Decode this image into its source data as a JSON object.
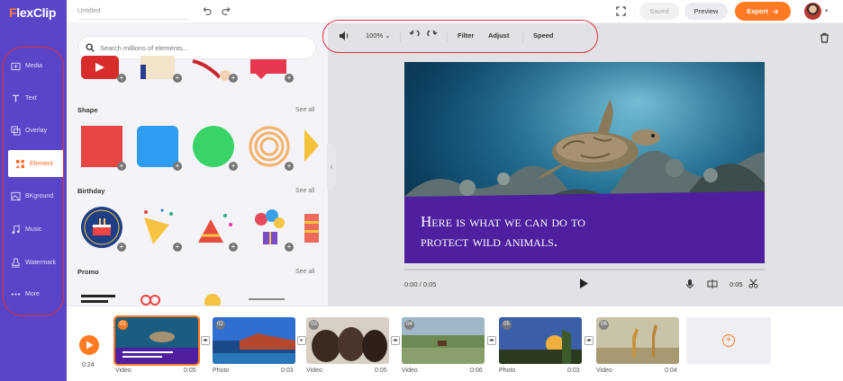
{
  "app": {
    "logo_f": "F",
    "logo_rest": "lexClip"
  },
  "colors": {
    "sidebar": "#5a44c7",
    "accent": "#ff7a22",
    "banner": "#4e1f9e",
    "highlight": "#e0323c"
  },
  "sidebar": {
    "items": [
      {
        "label": "Media",
        "icon": "media-icon"
      },
      {
        "label": "Text",
        "icon": "text-icon"
      },
      {
        "label": "Overlay",
        "icon": "overlay-icon"
      },
      {
        "label": "Element",
        "icon": "element-icon",
        "active": true
      },
      {
        "label": "BKground",
        "icon": "background-icon"
      },
      {
        "label": "Music",
        "icon": "music-icon"
      },
      {
        "label": "Watermark",
        "icon": "watermark-icon"
      },
      {
        "label": "More",
        "icon": "more-icon"
      }
    ]
  },
  "topbar": {
    "project_title": "Untitled",
    "saved_label": "Saved",
    "preview_label": "Preview",
    "export_label": "Export"
  },
  "panel": {
    "search_placeholder": "Search millions of elements...",
    "sections": [
      {
        "title": "Shape",
        "see_all": "See all"
      },
      {
        "title": "Birthday",
        "see_all": "See all"
      },
      {
        "title": "Promo",
        "see_all": "See all"
      }
    ]
  },
  "edit_toolbar": {
    "zoom": "100%",
    "filter": "Filter",
    "adjust": "Adjust",
    "speed": "Speed"
  },
  "video": {
    "title": "Here is what we can do to\nprotect wild animals.",
    "time_current": "0:00 / 0:05",
    "clip_duration": "0:05"
  },
  "timeline": {
    "total_time": "0:24",
    "clips": [
      {
        "index": "01",
        "type": "Video",
        "duration": "0:05"
      },
      {
        "index": "02",
        "type": "Photo",
        "duration": "0:03"
      },
      {
        "index": "03",
        "type": "Video",
        "duration": "0:05"
      },
      {
        "index": "04",
        "type": "Video",
        "duration": "0:06"
      },
      {
        "index": "05",
        "type": "Photo",
        "duration": "0:03"
      },
      {
        "index": "06",
        "type": "Video",
        "duration": "0:04"
      }
    ]
  }
}
